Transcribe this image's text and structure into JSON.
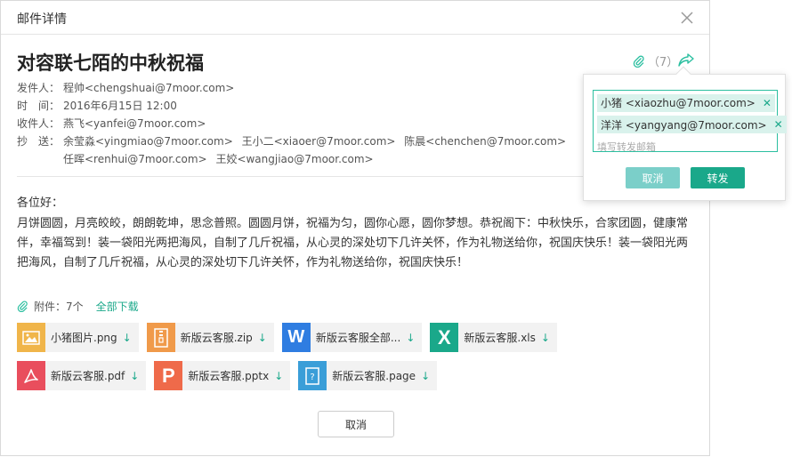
{
  "dialog": {
    "title": "邮件详情"
  },
  "mail": {
    "subject": "对容联七陌的中秋祝福",
    "attach_count": "（7）",
    "sender_label": "发件人：",
    "sender": "程帅<chengshuai@7moor.com>",
    "time_label": "时　间：",
    "time": "2016年6月15日  12:00",
    "to_label": "收件人：",
    "to": "燕飞<yanfei@7moor.com>",
    "cc_label": "抄　送：",
    "cc_line1": [
      "余莹淼<yingmiao@7moor.com>",
      "王小二<xiaoer@7moor.com>",
      "陈晨<chenchen@7moor.com>"
    ],
    "cc_line2": [
      "任晖<renhui@7moor.com>",
      "王姣<wangjiao@7moor.com>"
    ],
    "greeting": "各位好：",
    "body": "月饼圆圆，月亮皎皎，朗朗乾坤，思念普照。圆圆月饼，祝福为匀，圆你心愿，圆你梦想。恭祝阁下：中秋快乐，合家团圆，健康常伴，幸福驾到！装一袋阳光两把海风，自制了几斤祝福，从心灵的深处切下几许关怀，作为礼物送给你，祝国庆快乐！装一袋阳光两把海风，自制了几斤祝福，从心灵的深处切下几许关怀，作为礼物送给你，祝国庆快乐！"
  },
  "attachments": {
    "label": "附件：7个",
    "download_all": "全部下载",
    "files": [
      {
        "name": "小猪图片.png",
        "color": "#f0b54a",
        "icon": "image-icon"
      },
      {
        "name": "新版云客服.zip",
        "color": "#f09a4a",
        "icon": "zip-icon"
      },
      {
        "name": "新版云客服全部...",
        "color": "#2f7de1",
        "icon": "word-icon",
        "glyph": "W"
      },
      {
        "name": "新版云客服.xls",
        "color": "#1aa88a",
        "icon": "excel-icon",
        "glyph": "X"
      },
      {
        "name": "新版云客服.pdf",
        "color": "#e94e5d",
        "icon": "pdf-icon"
      },
      {
        "name": "新版云客服.pptx",
        "color": "#ef6a4a",
        "icon": "ppt-icon",
        "glyph": "P"
      },
      {
        "name": "新版云客服.page",
        "color": "#3a9ed8",
        "icon": "pages-icon"
      }
    ]
  },
  "footer": {
    "cancel": "取消"
  },
  "forward_popup": {
    "recipients": [
      "小猪 <xiaozhu@7moor.com>",
      "洋洋 <yangyang@7moor.com>"
    ],
    "placeholder": "填写转发邮箱",
    "cancel": "取消",
    "forward": "转发"
  }
}
